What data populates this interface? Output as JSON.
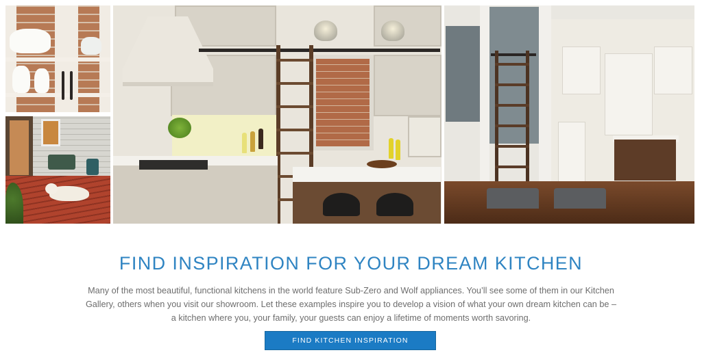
{
  "gallery": {
    "images": [
      {
        "name": "glass-cabinet-photo"
      },
      {
        "name": "porch-dog-photo"
      },
      {
        "name": "main-kitchen-photo"
      },
      {
        "name": "gray-wall-kitchen-photo"
      }
    ]
  },
  "content": {
    "headline": "FIND INSPIRATION FOR YOUR DREAM KITCHEN",
    "body": "Many of the most beautiful, functional kitchens in the world feature Sub-Zero and Wolf appliances. You’ll see some of them in our Kitchen Gallery, others when you visit our showroom. Let these examples inspire you to develop a vision of what your own dream kitchen can be – a kitchen where you, your family, your guests can enjoy a lifetime of moments worth savoring.",
    "cta_label": "FIND KITCHEN INSPIRATION"
  },
  "colors": {
    "accent": "#2f84c2",
    "button": "#1b7bc4",
    "body_text": "#6d6d6d"
  }
}
